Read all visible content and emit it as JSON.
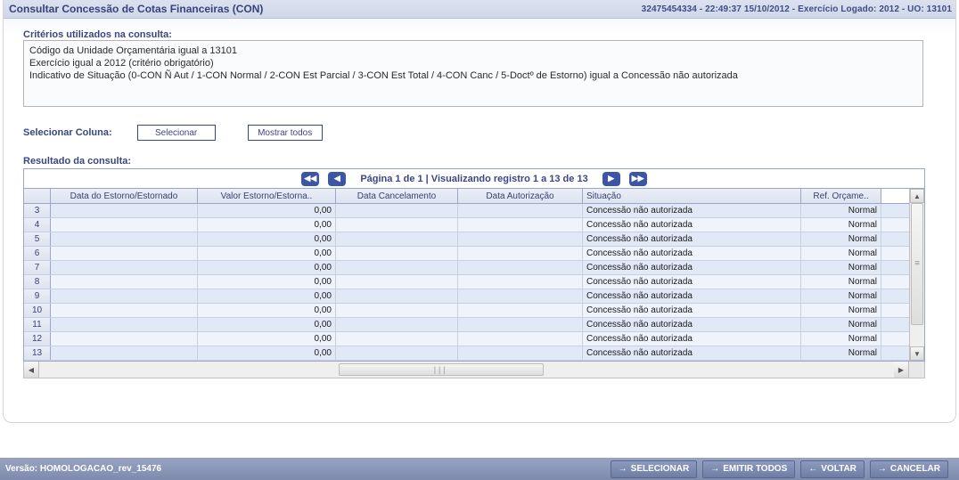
{
  "title": "Consultar Concessão de Cotas Financeiras (CON)",
  "header_right": "32475454334 - 22:49:37 15/10/2012 - Exercício Logado: 2012 - UO: 13101",
  "criteria": {
    "label": "Critérios utilizados na consulta:",
    "lines": [
      "Código da Unidade Orçamentária igual a 13101",
      "Exercício igual a 2012 (critério obrigatório)",
      "Indicativo de Situação (0-CON Ñ Aut / 1-CON Normal / 2-CON Est Parcial / 3-CON Est Total / 4-CON Canc / 5-Doctº de Estorno) igual a Concessão não autorizada"
    ]
  },
  "select_column": {
    "label": "Selecionar Coluna:",
    "select_btn": "Selecionar",
    "show_all_btn": "Mostrar todos"
  },
  "result_label": "Resultado da consulta:",
  "pager_text": "Página 1 de 1 | Visualizando registro 1 a 13 de 13",
  "columns": {
    "c1": "Data do Estorno/Estornado",
    "c2": "Valor Estorno/Estorna..",
    "c3": "Data Cancelamento",
    "c4": "Data Autorização",
    "c5": "Situação",
    "c6": "Ref. Orçame.."
  },
  "rows": [
    {
      "n": "3",
      "c2": "0,00",
      "c5": "Concessão não autorizada",
      "c6": "Normal"
    },
    {
      "n": "4",
      "c2": "0,00",
      "c5": "Concessão não autorizada",
      "c6": "Normal"
    },
    {
      "n": "5",
      "c2": "0,00",
      "c5": "Concessão não autorizada",
      "c6": "Normal"
    },
    {
      "n": "6",
      "c2": "0,00",
      "c5": "Concessão não autorizada",
      "c6": "Normal"
    },
    {
      "n": "7",
      "c2": "0,00",
      "c5": "Concessão não autorizada",
      "c6": "Normal"
    },
    {
      "n": "8",
      "c2": "0,00",
      "c5": "Concessão não autorizada",
      "c6": "Normal"
    },
    {
      "n": "9",
      "c2": "0,00",
      "c5": "Concessão não autorizada",
      "c6": "Normal"
    },
    {
      "n": "10",
      "c2": "0,00",
      "c5": "Concessão não autorizada",
      "c6": "Normal"
    },
    {
      "n": "11",
      "c2": "0,00",
      "c5": "Concessão não autorizada",
      "c6": "Normal"
    },
    {
      "n": "12",
      "c2": "0,00",
      "c5": "Concessão não autorizada",
      "c6": "Normal"
    },
    {
      "n": "13",
      "c2": "0,00",
      "c5": "Concessão não autorizada",
      "c6": "Normal"
    }
  ],
  "footer": {
    "version": "Versão: HOMOLOGACAO_rev_15476",
    "selecionar": "SELECIONAR",
    "emitir": "EMITIR TODOS",
    "voltar": "VOLTAR",
    "cancelar": "CANCELAR"
  }
}
